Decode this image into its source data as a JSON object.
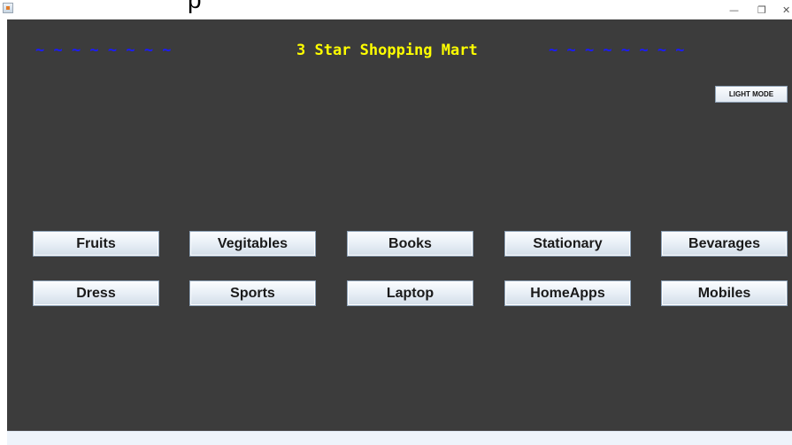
{
  "window": {
    "title_fragment": "p",
    "min_glyph": "—",
    "max_glyph": "❐",
    "close_glyph": "✕"
  },
  "header": {
    "tildes_left": "~ ~ ~ ~ ~ ~ ~ ~",
    "title": "3 Star Shopping Mart",
    "tildes_right": "~ ~ ~ ~ ~ ~ ~ ~",
    "tilde_color": "#1a1aff",
    "title_color": "#ffff00"
  },
  "mode_button": {
    "label": "LIGHT MODE"
  },
  "categories": {
    "row1": [
      "Fruits",
      "Vegitables",
      "Books",
      "Stationary",
      "Bevarages"
    ],
    "row2": [
      "Dress",
      "Sports",
      "Laptop",
      "HomeApps",
      "Mobiles"
    ]
  },
  "colors": {
    "panel_background": "#3c3c3c"
  }
}
